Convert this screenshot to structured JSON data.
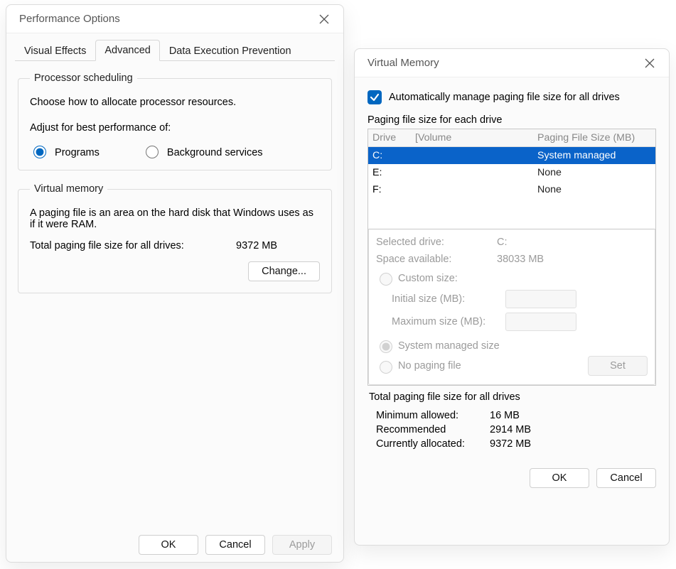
{
  "perf": {
    "title": "Performance Options",
    "tabs": {
      "visual_effects": "Visual Effects",
      "advanced": "Advanced",
      "dep": "Data Execution Prevention"
    },
    "processor_scheduling": {
      "legend": "Processor scheduling",
      "desc": "Choose how to allocate processor resources.",
      "adjust_label": "Adjust for best performance of:",
      "opt_programs": "Programs",
      "opt_bg": "Background services"
    },
    "virtual_memory": {
      "legend": "Virtual memory",
      "desc": "A paging file is an area on the hard disk that Windows uses as if it were RAM.",
      "total_label": "Total paging file size for all drives:",
      "total_value": "9372 MB",
      "change_btn": "Change..."
    },
    "buttons": {
      "ok": "OK",
      "cancel": "Cancel",
      "apply": "Apply"
    }
  },
  "vm": {
    "title": "Virtual Memory",
    "auto_label": "Automatically manage paging file size for all drives",
    "drives_label": "Paging file size for each drive",
    "header": {
      "drive": "Drive",
      "volume": "[Volume",
      "size": "Paging File Size (MB)"
    },
    "rows": [
      {
        "drive": "C:",
        "volume": "",
        "size": "System managed",
        "selected": true
      },
      {
        "drive": "E:",
        "volume": "",
        "size": "None",
        "selected": false
      },
      {
        "drive": "F:",
        "volume": "",
        "size": "None",
        "selected": false
      }
    ],
    "selected_drive_label": "Selected drive:",
    "selected_drive_value": "C:",
    "space_label": "Space available:",
    "space_value": "38033 MB",
    "opt_custom": "Custom size:",
    "initial_label": "Initial size (MB):",
    "max_label": "Maximum size (MB):",
    "opt_sysman": "System managed size",
    "opt_none": "No paging file",
    "set_btn": "Set",
    "totals_header": "Total paging file size for all drives",
    "min_label": "Minimum allowed:",
    "min_value": "16 MB",
    "rec_label": "Recommended",
    "rec_value": "2914 MB",
    "cur_label": "Currently allocated:",
    "cur_value": "9372 MB",
    "buttons": {
      "ok": "OK",
      "cancel": "Cancel"
    }
  }
}
